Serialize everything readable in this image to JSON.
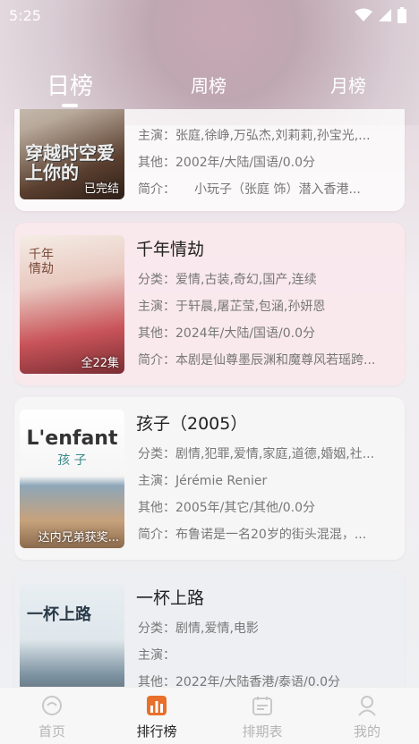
{
  "status": {
    "time": "5:25"
  },
  "tabs": [
    {
      "label": "日榜"
    },
    {
      "label": "周榜"
    },
    {
      "label": "月榜"
    }
  ],
  "cards": [
    {
      "badge": "已完结",
      "title": "",
      "lines": [
        "主演：张庭,徐峥,万弘杰,刘莉莉,孙宝光,...",
        "其他：2002年/大陆/国语/0.0分",
        "简介：　　小玩子（张庭 饰）潜入香港..."
      ]
    },
    {
      "badge": "全22集",
      "title": "千年情劫",
      "lines": [
        "分类：爱情,古装,奇幻,国产,连续",
        "主演：于轩晨,屠芷莹,包涵,孙妍恩",
        "其他：2024年/大陆/国语/0.0分",
        "简介：本剧是仙尊墨辰渊和魔尊风若瑶跨..."
      ]
    },
    {
      "badge": "达内兄弟获奖...",
      "title": "孩子（2005）",
      "lines": [
        "分类：剧情,犯罪,爱情,家庭,道德,婚姻,社...",
        "主演：Jérémie Renier",
        "其他：2005年/其它/其他/0.0分",
        "简介：布鲁诺是一名20岁的街头混混，..."
      ]
    },
    {
      "badge": "",
      "title": "一杯上路",
      "lines": [
        "分类：剧情,爱情,电影",
        "主演：",
        "其他：2022年/大陆香港/泰语/0.0分"
      ]
    }
  ],
  "posters": [
    {
      "text": "穿越时空爱上你的"
    },
    {
      "text": "千年情劫"
    },
    {
      "text_big": "L'enfant",
      "text_sub": "孩 子"
    },
    {
      "text": "一杯上路"
    }
  ],
  "nav": [
    {
      "label": "首页",
      "icon": "home-icon"
    },
    {
      "label": "排行榜",
      "icon": "ranking-icon"
    },
    {
      "label": "排期表",
      "icon": "calendar-icon"
    },
    {
      "label": "我的",
      "icon": "profile-icon"
    }
  ],
  "colors": {
    "accent": "#e8702a",
    "active_text": "#222222",
    "inactive_text": "#b5b5b5"
  }
}
